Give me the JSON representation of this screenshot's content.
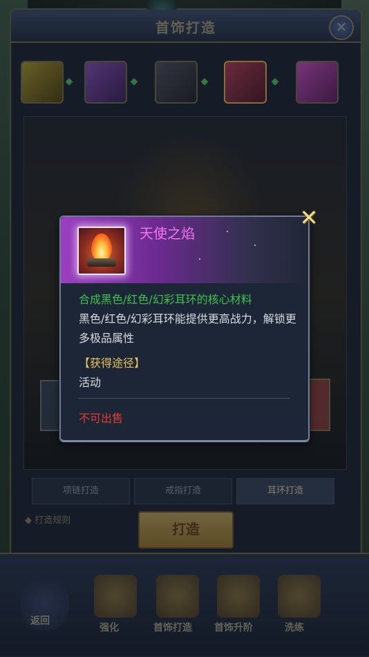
{
  "window": {
    "title": "首饰打造"
  },
  "chain": {
    "items": [
      {
        "name": "chain-item-1",
        "color": "#8a7a2a"
      },
      {
        "name": "chain-item-2",
        "color": "#6b3a8a"
      },
      {
        "name": "chain-item-3",
        "color": "#4a3a2a"
      },
      {
        "name": "chain-item-4",
        "color": "#8a2a3a"
      },
      {
        "name": "chain-item-5",
        "color": "#8a2a8a"
      }
    ]
  },
  "tabs": [
    {
      "label": "项链打造"
    },
    {
      "label": "戒指打造"
    },
    {
      "label": "耳环打造"
    }
  ],
  "craft": {
    "rule_label": "打造规则",
    "button_label": "打造"
  },
  "bottom_nav": {
    "back_label": "返回",
    "items": [
      {
        "label": "强化"
      },
      {
        "label": "首饰打造"
      },
      {
        "label": "首饰升阶"
      },
      {
        "label": "洗练"
      }
    ]
  },
  "popup": {
    "item_name": "天使之焰",
    "desc_green": "合成黑色/红色/幻彩耳环的核心材料",
    "desc_white": "黑色/红色/幻彩耳环能提供更高战力，解锁更多极品属性",
    "source_title": "【获得途径】",
    "source_value": "活动",
    "sell_status": "不可出售",
    "close_icon": "close-x-icon"
  }
}
